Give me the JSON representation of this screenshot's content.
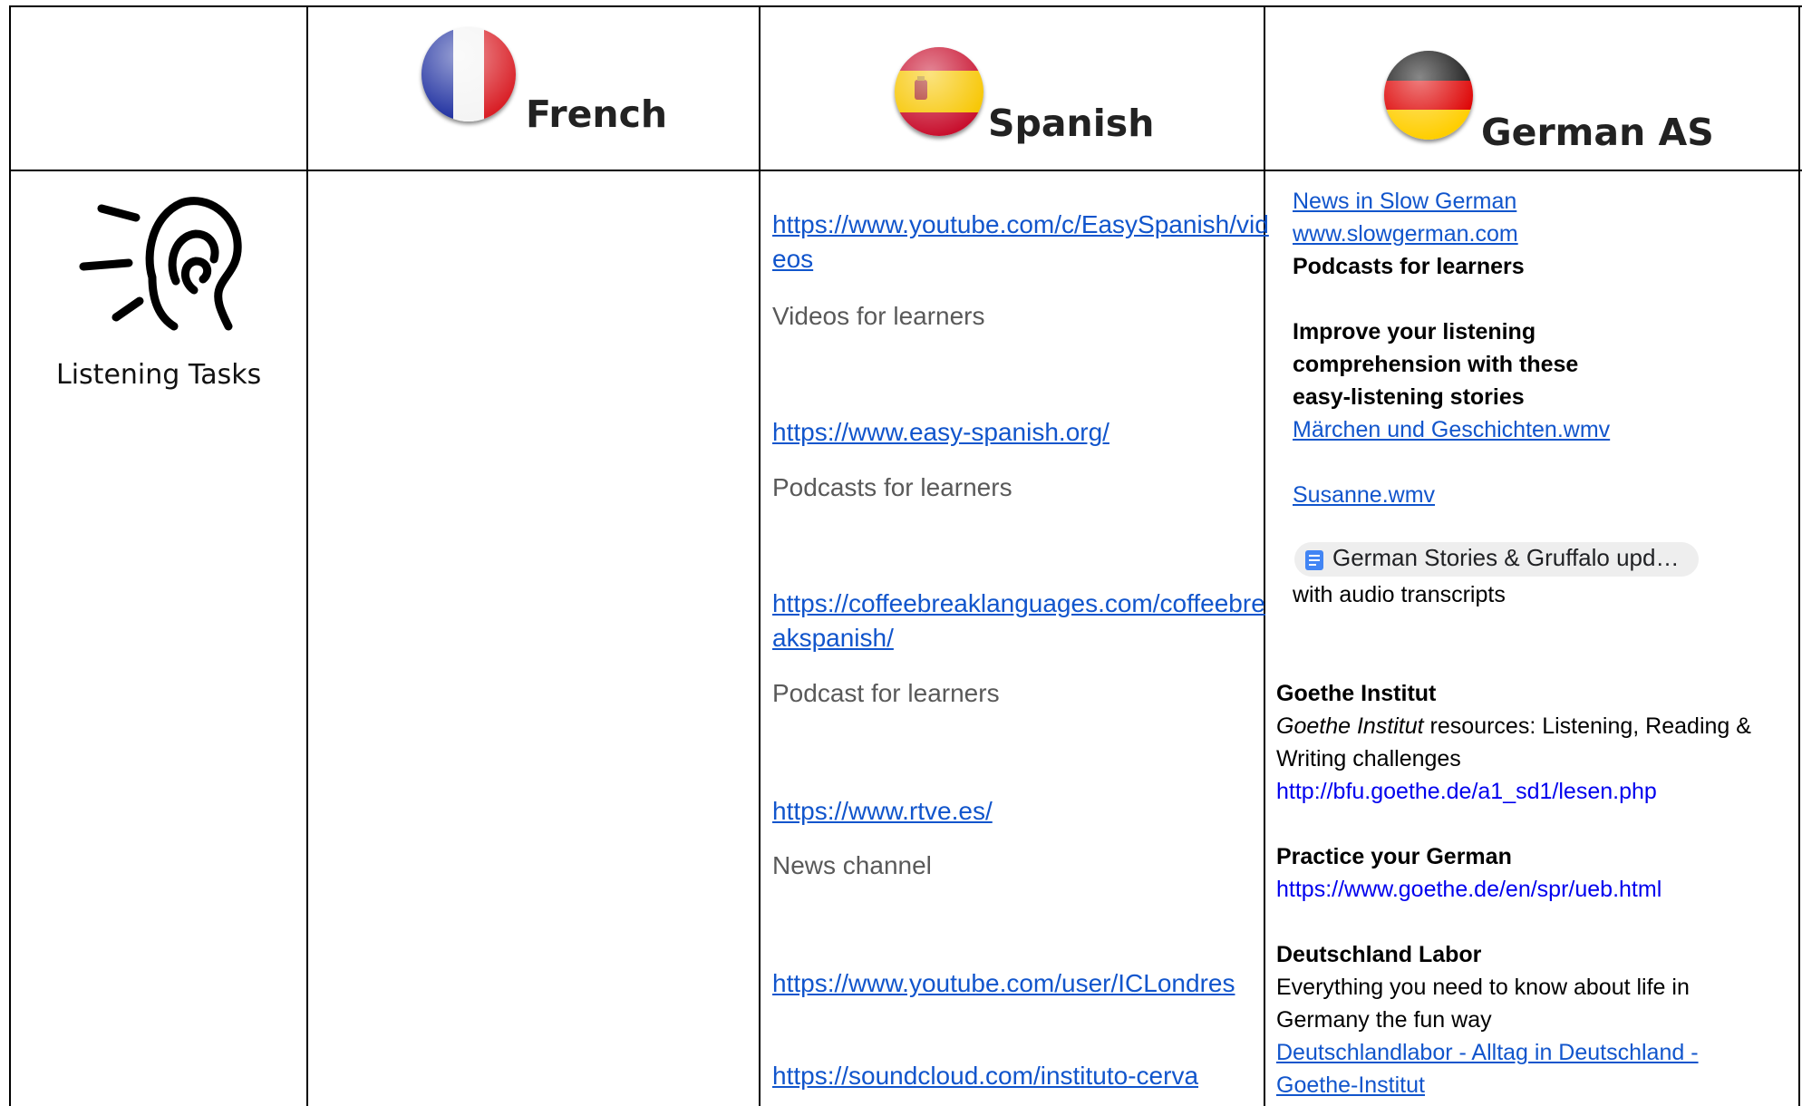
{
  "table": {
    "headers": {
      "french": "French",
      "spanish": "Spanish",
      "german": "German AS"
    },
    "row_label": "Listening Tasks",
    "spanish": [
      {
        "url": "https://www.youtube.com/c/EasySpanish/videos",
        "desc": "Videos for learners"
      },
      {
        "url": "https://www.easy-spanish.org/",
        "desc": "Podcasts for learners"
      },
      {
        "url": "https://coffeebreaklanguages.com/coffeebreakspanish/",
        "desc": "Podcast for learners"
      },
      {
        "url": "https://www.rtve.es/",
        "desc": "News channel"
      },
      {
        "url": "https://www.youtube.com/user/ICLondres",
        "desc": ""
      },
      {
        "url": "https://soundcloud.com/instituto-cerva",
        "desc": ""
      }
    ],
    "german": {
      "slow_german_link": "News in Slow German",
      "slow_german_url": "www.slowgerman.com",
      "podcasts": "Podcasts for learners",
      "improve_1": "Improve your listening",
      "improve_2": "comprehension with these",
      "improve_3": "easy-listening stories",
      "maerchen": "Märchen und Geschichten.wmv",
      "susanne": "Susanne.wmv",
      "chip": "German Stories & Gruffalo upd…",
      "chip_note": "with audio transcripts",
      "goethe_title": "Goethe Institut",
      "goethe_desc_italic": "Goethe Institut",
      "goethe_desc_rest": " resources: Listening, Reading &",
      "goethe_desc_2": "Writing challenges",
      "goethe_url": "http://bfu.goethe.de/a1_sd1/lesen.php",
      "practice_title": "Practice your German",
      "practice_url": "https://www.goethe.de/en/spr/ueb.html",
      "labor_title": "Deutschland Labor",
      "labor_desc_1": "Everything you need to know about life in",
      "labor_desc_2": "Germany the fun way",
      "labor_link_1": "Deutschlandlabor - Alltag in Deutschland -",
      "labor_link_2": "Goethe-Institut"
    }
  },
  "colors": {
    "link": "#1155cc",
    "plain_link": "#0000ee",
    "muted_text": "#595959",
    "border": "#000000"
  },
  "icons": [
    "france-flag-icon",
    "spain-flag-icon",
    "germany-flag-icon",
    "ear-listening-icon",
    "google-docs-icon"
  ]
}
